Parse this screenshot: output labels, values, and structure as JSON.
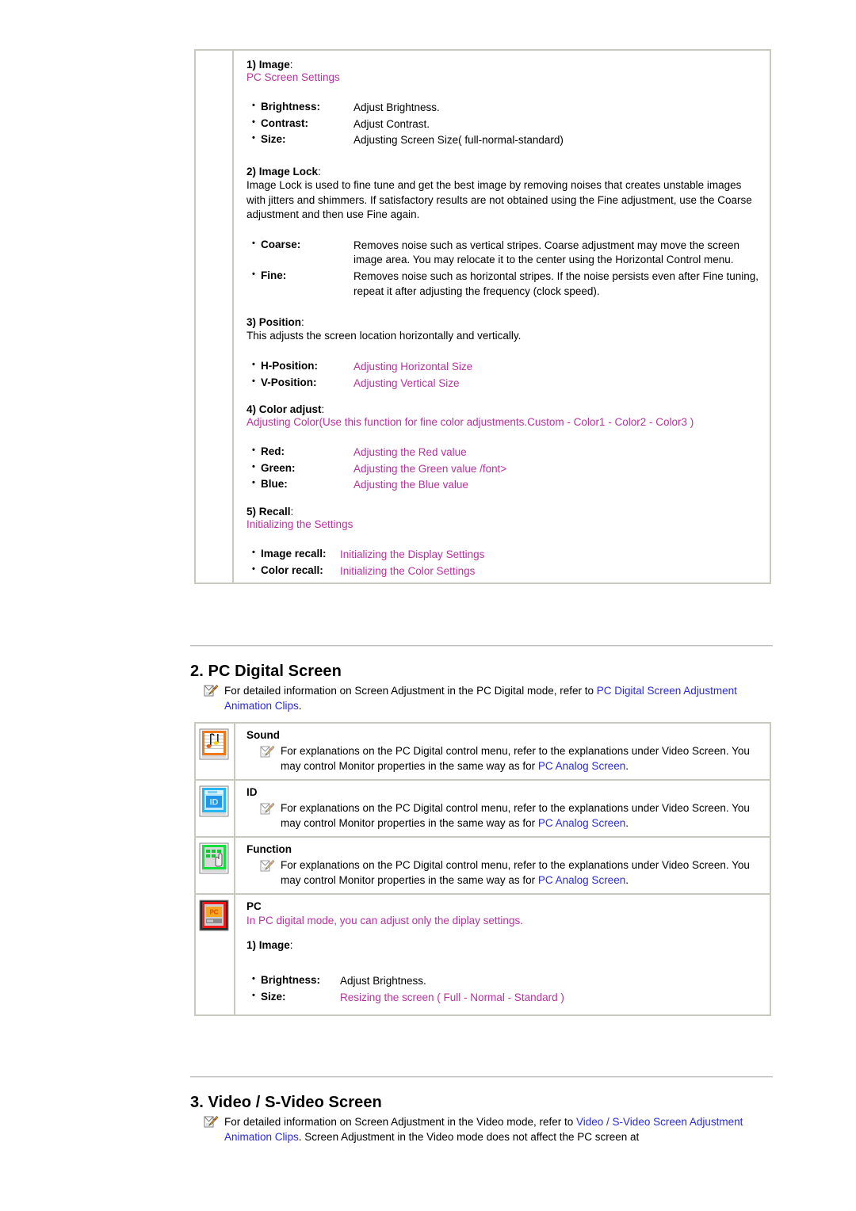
{
  "colors": {
    "magenta": "#b5339e",
    "link_blue": "#2a2ad8",
    "border_gray": "#c9c9c0",
    "rule_gray": "#bdbdbd"
  },
  "section1": {
    "image": {
      "heading_num": "1) Image",
      "heading_colon": ":",
      "subtitle": "PC Screen Settings",
      "items": [
        {
          "term": "Brightness:",
          "desc": "Adjust Brightness.",
          "desc_color": "black"
        },
        {
          "term": "Contrast:",
          "desc": "Adjust Contrast.",
          "desc_color": "black"
        },
        {
          "term": "Size:",
          "desc": "Adjusting Screen Size( full-normal-standard)",
          "desc_color": "black"
        }
      ]
    },
    "image_lock": {
      "heading_num": "2) Image Lock",
      "heading_colon": ":",
      "paragraph": "Image Lock is used to fine tune and get the best image by removing noises that creates unstable images with jitters and shimmers. If satisfactory results are not obtained using the Fine adjustment, use the Coarse adjustment and then use Fine again.",
      "items": [
        {
          "term": "Coarse:",
          "desc": "Removes noise such as vertical stripes. Coarse adjustment may move the screen image area. You may relocate it to the center using the Horizontal Control menu.",
          "desc_color": "black"
        },
        {
          "term": "Fine:",
          "desc": "Removes noise such as horizontal stripes. If the noise persists even after Fine tuning, repeat it after adjusting the frequency (clock speed).",
          "desc_color": "black"
        }
      ]
    },
    "position": {
      "heading_num": "3) Position",
      "heading_colon": ":",
      "paragraph": "This adjusts the screen location horizontally and vertically.",
      "items": [
        {
          "term": "H-Position:",
          "desc": "Adjusting Horizontal Size",
          "desc_color": "magenta"
        },
        {
          "term": "V-Position:",
          "desc": "Adjusting Vertical Size",
          "desc_color": "magenta"
        }
      ]
    },
    "color_adjust": {
      "heading_num": "4) Color adjust",
      "heading_colon": ":",
      "subtitle": "Adjusting Color(Use this function for fine color adjustments.Custom - Color1 - Color2 - Color3 )",
      "items": [
        {
          "term": "Red:",
          "desc": "Adjusting the Red value",
          "desc_color": "magenta"
        },
        {
          "term": "Green:",
          "desc": "Adjusting the Green value /font>",
          "desc_color": "magenta"
        },
        {
          "term": "Blue:",
          "desc": "Adjusting the Blue value",
          "desc_color": "magenta"
        }
      ]
    },
    "recall": {
      "heading_num": "5) Recall",
      "heading_colon": ":",
      "subtitle": "Initializing the Settings",
      "items": [
        {
          "term": "Image recall:",
          "desc": "Initializing the Display Settings",
          "desc_color": "magenta"
        },
        {
          "term": "Color recall:",
          "desc": "Initializing the Color Settings",
          "desc_color": "magenta"
        }
      ]
    }
  },
  "section2": {
    "title": "2. PC Digital Screen",
    "note_icon": "notepad-pencil-icon",
    "intro_pre": "For detailed information on Screen Adjustment in the PC Digital mode, refer to ",
    "intro_link": "PC Digital Screen Adjustment Animation Clips",
    "intro_post": ".",
    "rows": [
      {
        "icon": "sound-icon",
        "title": "Sound",
        "note_icon": "notepad-pencil-icon",
        "text_pre": "For explanations on the PC Digital control menu, refer to the explanations under Video Screen. You may control Monitor properties in the same way as for ",
        "link": "PC Analog Screen",
        "text_post": "."
      },
      {
        "icon": "id-icon",
        "title": "ID",
        "note_icon": "notepad-pencil-icon",
        "text_pre": "For explanations on the PC Digital control menu, refer to the explanations under Video Screen. You may control Monitor properties in the same way as for ",
        "link": "PC Analog Screen",
        "text_post": "."
      },
      {
        "icon": "function-icon",
        "title": "Function",
        "note_icon": "notepad-pencil-icon",
        "text_pre": "For explanations on the PC Digital control menu, refer to the explanations under Video Screen. You may control Monitor properties in the same way as for ",
        "link": "PC Analog Screen",
        "text_post": "."
      }
    ],
    "pc_row": {
      "icon": "pc-monitor-icon",
      "title": "PC",
      "notice": "In PC digital mode, you can adjust only the diplay settings.",
      "image_heading_num": "1) Image",
      "image_heading_colon": ":",
      "items": [
        {
          "term": "Brightness:",
          "desc": "Adjust Brightness.",
          "desc_color": "black"
        },
        {
          "term": "Size:",
          "desc": "Resizing the screen ( Full - Normal - Standard )",
          "desc_color": "magenta"
        }
      ]
    }
  },
  "section3": {
    "title": "3. Video / S-Video Screen",
    "note_icon": "notepad-pencil-icon",
    "intro_pre": "For detailed information on Screen Adjustment in the Video mode, refer to ",
    "intro_link": "Video / S-Video Screen Adjustment Animation Clips",
    "intro_post": ". Screen Adjustment in the Video mode does not affect the PC screen at"
  }
}
